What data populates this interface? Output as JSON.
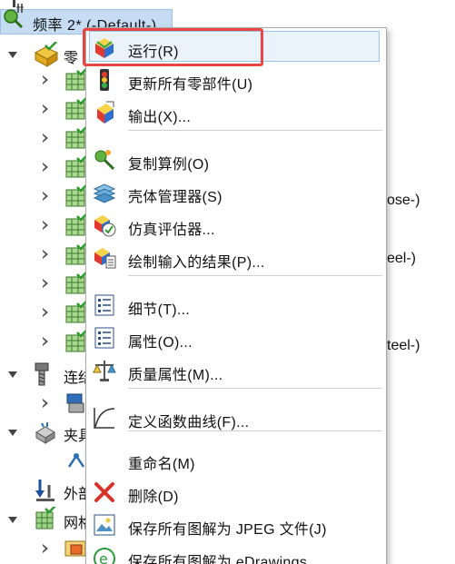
{
  "tree": {
    "study_label": "频率 2* (-Default-)",
    "parts_label": "零",
    "connections_label": "连结",
    "fixtures_label": "夹具",
    "loads_label": "外部",
    "mesh_label": "网格",
    "partial_suffix_1": "ose-)",
    "partial_suffix_2": "eel-)",
    "partial_suffix_3": "teel-)"
  },
  "menu": {
    "items": [
      {
        "label": "运行(R)",
        "icon": "run-icon"
      },
      {
        "label": "更新所有零部件(U)",
        "icon": "traffic-light-icon"
      },
      {
        "label": "输出(X)...",
        "icon": "export-icon"
      },
      {
        "label": "复制算例(O)",
        "icon": "copy-study-icon"
      },
      {
        "label": "壳体管理器(S)",
        "icon": "shell-manager-icon"
      },
      {
        "label": "仿真评估器...",
        "icon": "simulation-evaluator-icon"
      },
      {
        "label": "绘制输入的结果(P)...",
        "icon": "plot-imported-results-icon"
      },
      {
        "label": "细节(T)...",
        "icon": "details-icon"
      },
      {
        "label": "属性(O)...",
        "icon": "properties-icon"
      },
      {
        "label": "质量属性(M)...",
        "icon": "mass-properties-icon"
      },
      {
        "label": "定义函数曲线(F)...",
        "icon": "function-curve-icon"
      },
      {
        "label": "重命名(M)",
        "icon": ""
      },
      {
        "label": "删除(D)",
        "icon": "delete-icon"
      },
      {
        "label": "保存所有图解为 JPEG 文件(J)",
        "icon": "save-jpeg-icon"
      },
      {
        "label": "保存所有图解为 eDrawings",
        "icon": "edrawings-icon"
      }
    ]
  },
  "colors": {
    "selection_fill": "#c5dcf3",
    "highlight_border": "#e84545",
    "menu_hover": "#eaf3fc"
  }
}
